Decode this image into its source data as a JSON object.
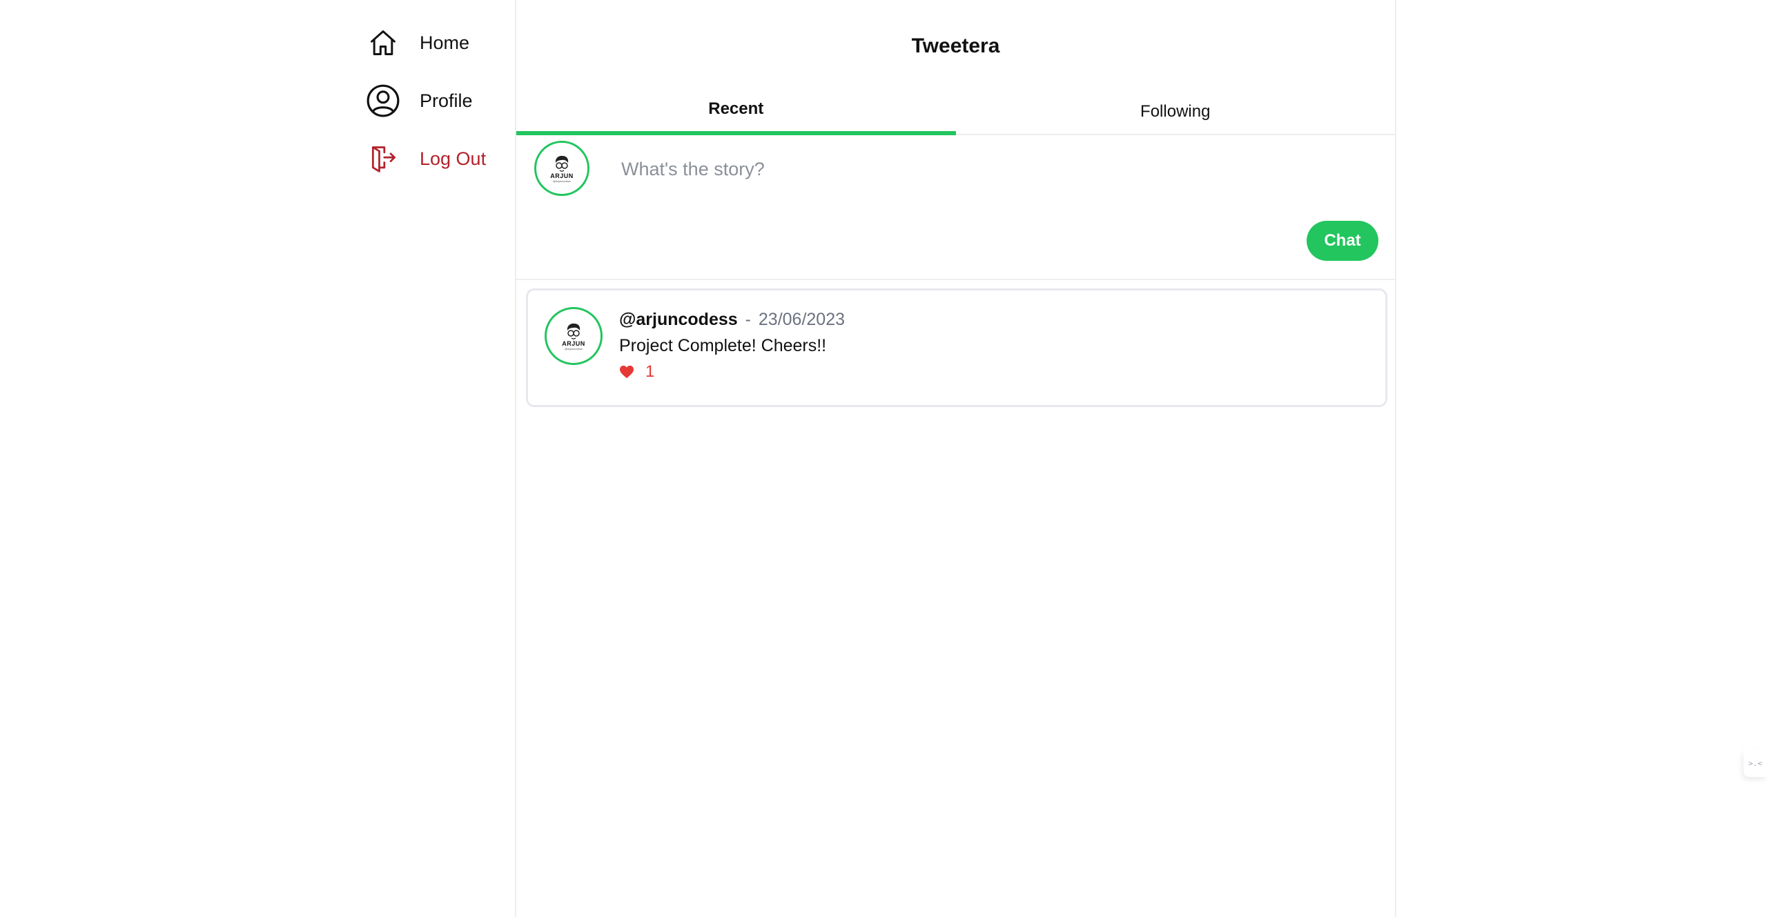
{
  "sidebar": {
    "items": [
      {
        "label": "Home",
        "icon": "home-icon"
      },
      {
        "label": "Profile",
        "icon": "user-circle-icon"
      },
      {
        "label": "Log Out",
        "icon": "logout-icon",
        "color": "#b3212b"
      }
    ]
  },
  "header": {
    "title": "Tweetera"
  },
  "tabs": [
    {
      "label": "Recent",
      "active": true
    },
    {
      "label": "Following",
      "active": false
    }
  ],
  "composer": {
    "placeholder": "What's the story?",
    "value": "",
    "submit_label": "Chat",
    "avatar_text": "ARJUN",
    "avatar_sub": "@arjuncodess"
  },
  "posts": [
    {
      "username": "@arjuncodess",
      "separator": "-",
      "date": "23/06/2023",
      "body": "Project Complete! Cheers!!",
      "likes": "1",
      "avatar_text": "ARJUN",
      "avatar_sub": "@arjuncodess"
    }
  ],
  "edge_widget": {
    "text": ">.<"
  },
  "colors": {
    "accent": "#22c55e",
    "danger": "#b3212b",
    "like": "#e53935",
    "muted": "#6b7280"
  }
}
